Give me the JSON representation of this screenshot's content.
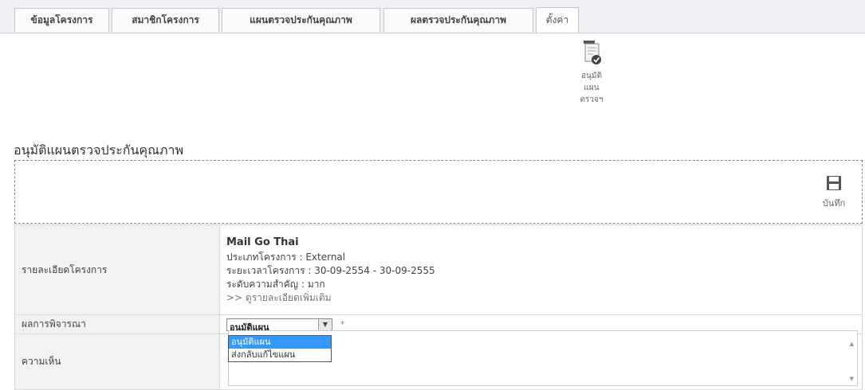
{
  "tabs": [
    {
      "label": "ข้อมูลโครงการ"
    },
    {
      "label": "สมาชิกโครงการ"
    },
    {
      "label": "แผนตรวจประกันคุณภาพ"
    },
    {
      "label": "ผลตรวจประกันคุณภาพ"
    },
    {
      "label": "ตั้งค่า",
      "active": true
    }
  ],
  "toolbar": {
    "approve_label_1": "อนุมัติ",
    "approve_label_2": "แผน",
    "approve_label_3": "ตรวจฯ",
    "save_label": "บันทึก"
  },
  "page_title": "อนุมัติแผนตรวจประกันคุณภาพ",
  "form": {
    "project_detail_label": "รายละเอียดโครงการ",
    "project_name": "Mail Go Thai",
    "project_type": "ประเภทโครงการ : External",
    "project_period": "ระยะเวลาโครงการ : 30-09-2554 - 30-09-2555",
    "importance": "ระดับความสำคัญ : มาก",
    "more_link": ">> ดูรายละเอียดเพิ่มเติม",
    "result_label": "ผลการพิจารณา",
    "result_selected": "อนุมัติแผน",
    "result_options": [
      "อนุมัติแผน",
      "ส่งกลับแก้ไขแผน"
    ],
    "required_mark": "*",
    "comment_label": "ความเห็น"
  },
  "colors": {
    "tab_bar": "#eef0f3",
    "label_cell": "#f2f2f2",
    "highlight": "#3399ff"
  }
}
